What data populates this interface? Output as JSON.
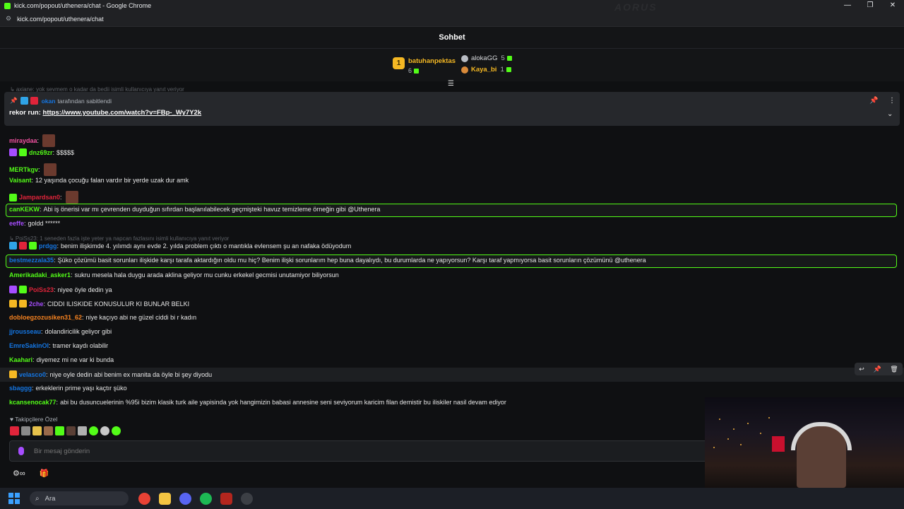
{
  "window": {
    "title": "kick.com/popout/uthenera/chat - Google Chrome",
    "url": "kick.com/popout/uthenera/chat",
    "brand": "AORUS",
    "minimize": "—",
    "restore": "❐",
    "close": "✕"
  },
  "chat": {
    "title": "Sohbet"
  },
  "leaderboard": {
    "first": {
      "rank": "1",
      "name": "batuhanpektas",
      "count": "6"
    },
    "second": {
      "name": "alokaGG",
      "count": "5"
    },
    "third": {
      "name": "Kaya_bi",
      "count": "1"
    }
  },
  "reply_hint_top": "↳ axiane: yok sevmem o kadar da bedii isimli kullanıcıya yanıt veriyor",
  "pinned": {
    "pinned_by_user": "okan",
    "pinned_by_suffix": "tarafından sabitlendi",
    "text_prefix": "rekor run:",
    "link": "https://www.youtube.com/watch?v=FBp-_Wy7Y2k"
  },
  "messages": [
    {
      "user": "miraydaa",
      "text": "",
      "color": "#f0509f"
    },
    {
      "user": "dnz69zr",
      "text": "$$$$$",
      "color": "#53fc18"
    },
    {
      "user": "MERTkgv",
      "text": "",
      "color": "#53fc18"
    },
    {
      "user": "Vaisant",
      "text": "12 yaşında çocuğu falan vardır bir yerde uzak dur amk",
      "color": "#53fc18"
    },
    {
      "user": "Jampardsan0",
      "text": "",
      "color": "#e0243a"
    },
    {
      "user": "canKEKW",
      "text": "Abi iş önerisi var mı çevrenden duyduğun sıfırdan başlanılabilecek geçmişteki havuz temizleme örneğin gibi @Uthenera",
      "color": "#53fc18"
    },
    {
      "user": "eeffe",
      "text": "goldd ******",
      "color": "#a64dff"
    },
    {
      "user": "prdgg",
      "text": "benim ilişkimde 4. yılımdı aynı evde 2. yılda problem çıktı o mantıkla evlensem şu an nafaka ödüyodum",
      "color": "#1475e1"
    },
    {
      "user": "bestmezzala35",
      "text": "Şüko çözümü basit sorunları ilişkide karşı tarafa aktardığın oldu mu hiç? Benim ilişki sorunlarım hep buna dayalıydı, bu durumlarda ne yapıyorsun? Karşı taraf yapmıyorsa basit sorunların çözümünü @uthenera",
      "color": "#1475e1"
    },
    {
      "user": "Amerikadaki_asker1",
      "text": "sukru mesela hala duygu arada aklina geliyor mu cunku erkekel gecmisi unutamiyor biliyorsun",
      "color": "#53fc18"
    },
    {
      "user": "PoiSs23",
      "text": "niyee öyle dedin ya",
      "color": "#e0243a"
    },
    {
      "user": "2che",
      "text": "CIDDI ILISKIDE KONUSULUR KI BUNLAR BELKI",
      "color": "#a64dff"
    },
    {
      "user": "dobloegzozusiken31_62",
      "text": "niye kaçıyo abi ne güzel ciddi bi r kadın",
      "color": "#f58220"
    },
    {
      "user": "jjrousseau",
      "text": "dolandiricilik geliyor gibi",
      "color": "#1475e1"
    },
    {
      "user": "EmreSakinOl",
      "text": "tramer kaydı olabilir",
      "color": "#1475e1"
    },
    {
      "user": "Kaahari",
      "text": "diyemez mi ne var ki bunda",
      "color": "#53fc18"
    },
    {
      "user": "velasco0",
      "text": "niye oyle dedin abi benim ex manita da öyle bi şey diyodu",
      "color": "#1475e1"
    },
    {
      "user": "sbaggg",
      "text": "erkeklerin prime yaşı kaçtır şüko",
      "color": "#1475e1"
    },
    {
      "user": "kcansenocak77",
      "text": "abi bu dusuncuelerinin %95i bizim klasik turk aile yapisinda yok hangimizin babasi annesine seni seviyorum karicim filan demistir bu iliskiler nasil devam ediyor",
      "color": "#53fc18"
    }
  ],
  "reply_hint_mid": "↳ PoiSs23: 1 seneden fazla işte yeter ya napcan fazlasını isimli kullanıcıya yanıt veriyor",
  "followers_label": "Takipçilere Özel",
  "input": {
    "placeholder": "Bir mesaj gönderin"
  },
  "taskbar": {
    "search_label": "Ara"
  }
}
